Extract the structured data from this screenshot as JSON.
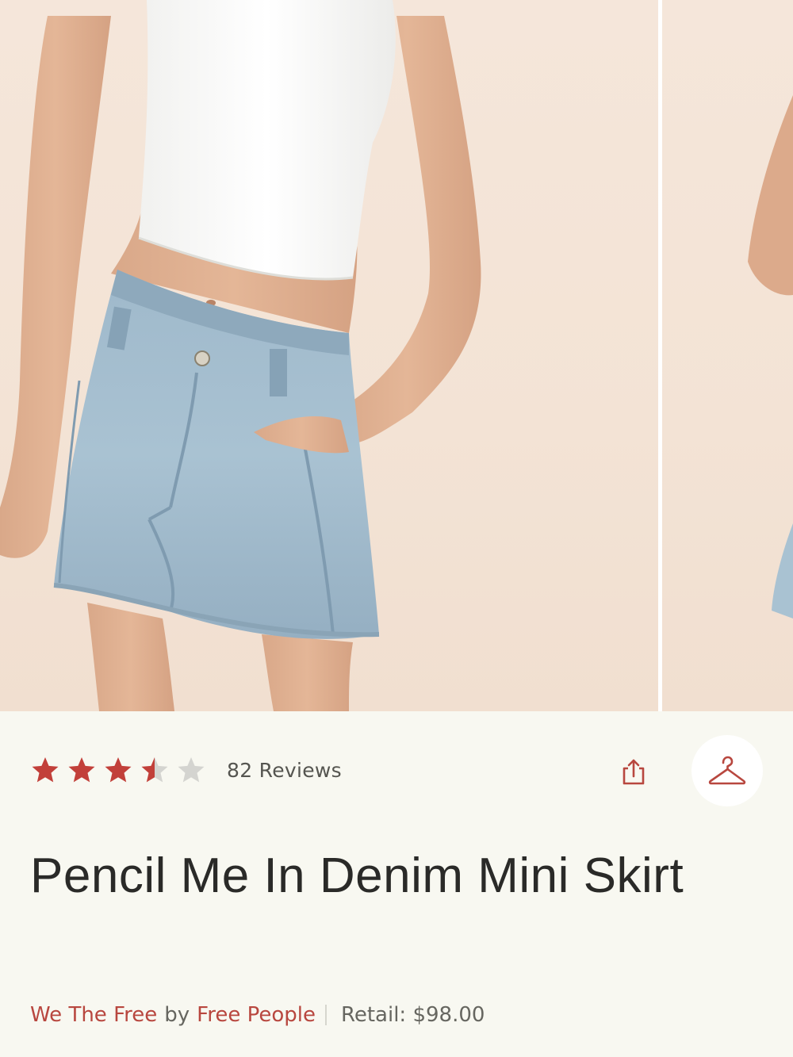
{
  "product": {
    "rating": 3.5,
    "rating_max": 5,
    "reviews_label": "82 Reviews",
    "title": "Pencil Me In Denim Mini Skirt",
    "brand": "We The Free",
    "by_label": "by",
    "maker": "Free People",
    "retail_label": "Retail: $98.00"
  },
  "images": {
    "main_alt": "Model wearing a white cropped tank top and a light-wash denim mini skirt",
    "next_alt": "Next product photo"
  },
  "icons": {
    "share": "share-icon",
    "hanger": "hanger-icon",
    "star": "star-icon"
  },
  "colors": {
    "star_filled": "#c2403a",
    "star_empty": "#d4d4d0",
    "accent_link": "#b8473f",
    "title": "#2a2a28",
    "background": "#f8f8f1"
  }
}
